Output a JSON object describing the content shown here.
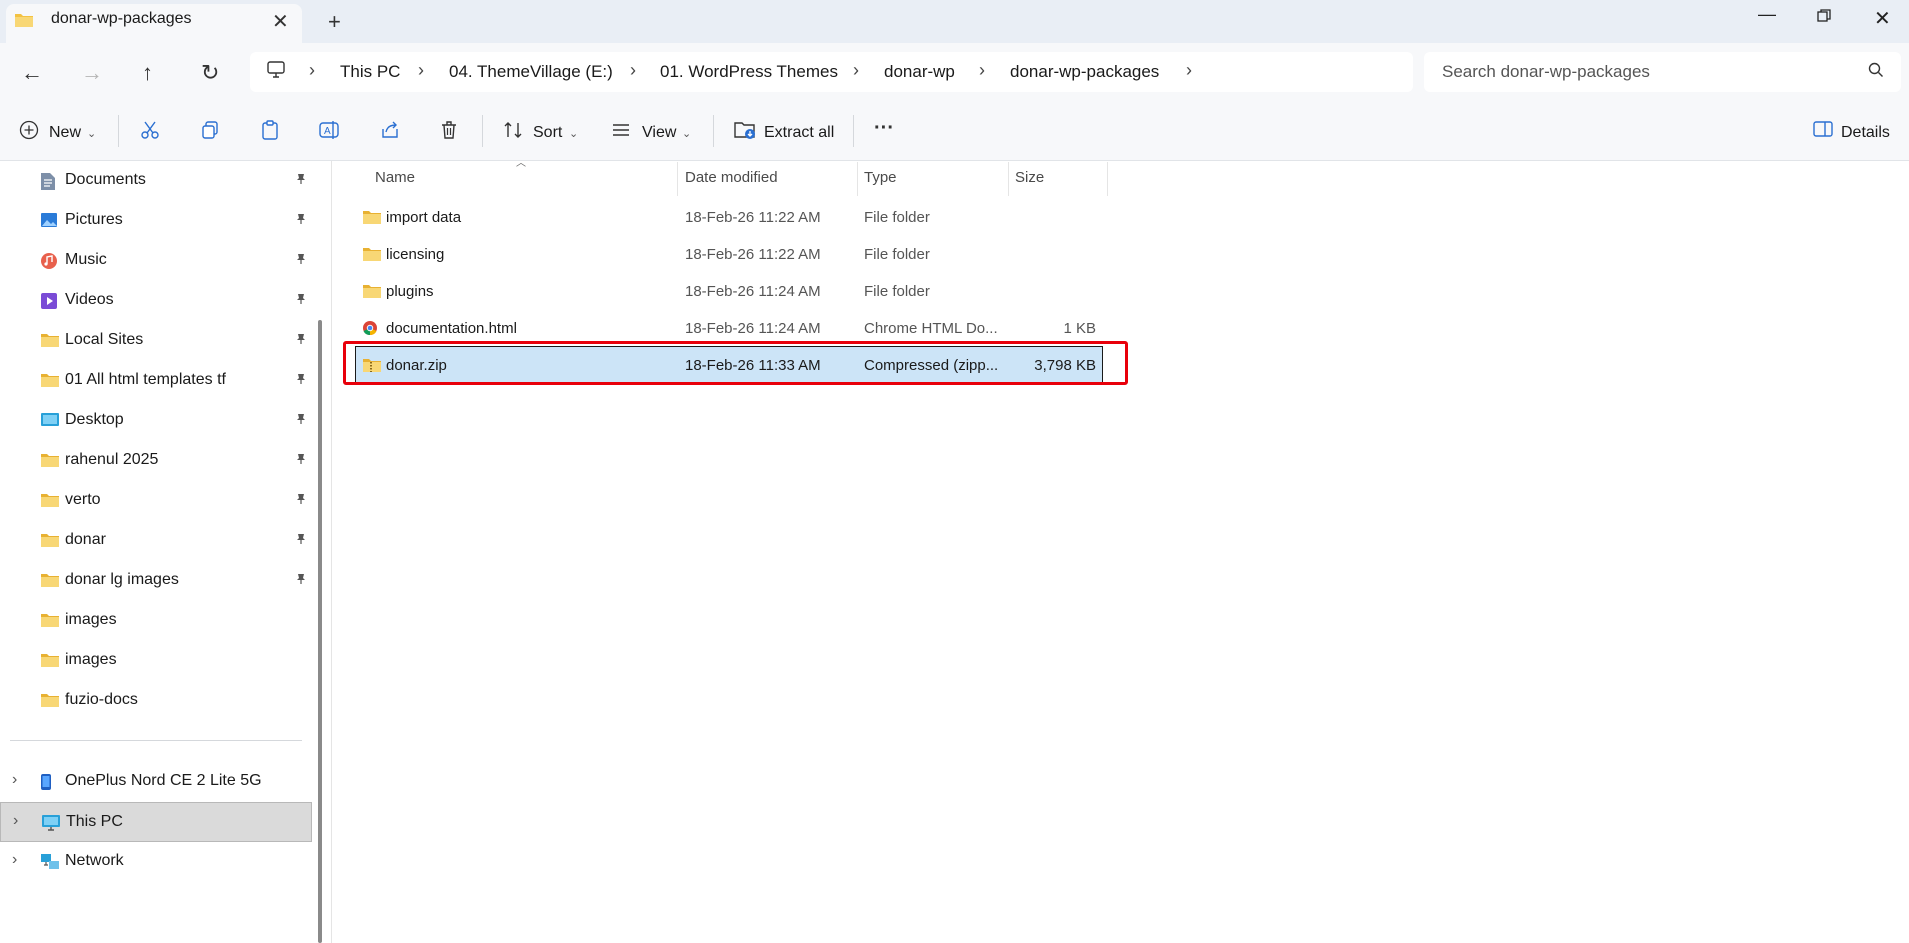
{
  "window": {
    "tab_title": "donar-wp-packages",
    "new_tab_label": "+",
    "close_label": "✕",
    "minimize_label": "—",
    "win_close_label": "✕"
  },
  "nav": {
    "back_label": "←",
    "forward_label": "→",
    "up_label": "↑",
    "refresh_label": "↻"
  },
  "breadcrumb": [
    "This PC",
    "04. ThemeVillage (E:)",
    "01. WordPress Themes",
    "donar-wp",
    "donar-wp-packages"
  ],
  "breadcrumb_sep": "›",
  "search": {
    "placeholder": "Search donar-wp-packages"
  },
  "toolbar": {
    "new_label": "New",
    "sort_label": "Sort",
    "view_label": "View",
    "extract_label": "Extract all",
    "more_label": "···",
    "details_label": "Details"
  },
  "sidebar": {
    "quick_access": [
      {
        "label": "Documents",
        "icon": "documents-icon",
        "pinned": true
      },
      {
        "label": "Pictures",
        "icon": "pictures-icon",
        "pinned": true
      },
      {
        "label": "Music",
        "icon": "music-icon",
        "pinned": true
      },
      {
        "label": "Videos",
        "icon": "videos-icon",
        "pinned": true
      },
      {
        "label": "Local Sites",
        "icon": "folder-icon",
        "pinned": true
      },
      {
        "label": "01 All html templates tf",
        "icon": "folder-icon",
        "pinned": true
      },
      {
        "label": "Desktop",
        "icon": "desktop-icon",
        "pinned": true
      },
      {
        "label": "rahenul 2025",
        "icon": "folder-icon",
        "pinned": true
      },
      {
        "label": "verto",
        "icon": "folder-icon",
        "pinned": true
      },
      {
        "label": "donar",
        "icon": "folder-icon",
        "pinned": true
      },
      {
        "label": "donar lg images",
        "icon": "folder-icon",
        "pinned": true
      },
      {
        "label": "images",
        "icon": "folder-icon",
        "pinned": false
      },
      {
        "label": "images",
        "icon": "folder-icon",
        "pinned": false
      },
      {
        "label": "fuzio-docs",
        "icon": "folder-icon",
        "pinned": false
      }
    ],
    "devices": [
      {
        "label": "OnePlus Nord CE 2 Lite 5G",
        "icon": "phone-icon"
      },
      {
        "label": "This PC",
        "icon": "pc-icon",
        "selected": true
      },
      {
        "label": "Network",
        "icon": "network-icon"
      }
    ],
    "expander": "›"
  },
  "columns": {
    "name": "Name",
    "date": "Date modified",
    "type": "Type",
    "size": "Size"
  },
  "files": [
    {
      "name": "import data",
      "date": "18-Feb-26 11:22 AM",
      "type": "File folder",
      "size": "",
      "icon": "folder-icon"
    },
    {
      "name": "licensing",
      "date": "18-Feb-26 11:22 AM",
      "type": "File folder",
      "size": "",
      "icon": "folder-icon"
    },
    {
      "name": "plugins",
      "date": "18-Feb-26 11:24 AM",
      "type": "File folder",
      "size": "",
      "icon": "folder-icon"
    },
    {
      "name": "documentation.html",
      "date": "18-Feb-26 11:24 AM",
      "type": "Chrome HTML Do...",
      "size": "1 KB",
      "icon": "chrome-html-icon"
    },
    {
      "name": "donar.zip",
      "date": "18-Feb-26 11:33 AM",
      "type": "Compressed (zipp...",
      "size": "3,798 KB",
      "icon": "zip-folder-icon",
      "selected": true
    }
  ],
  "colors": {
    "selection": "#cce4f7",
    "highlight_box": "#e8000b",
    "folder": "#f3c242"
  }
}
